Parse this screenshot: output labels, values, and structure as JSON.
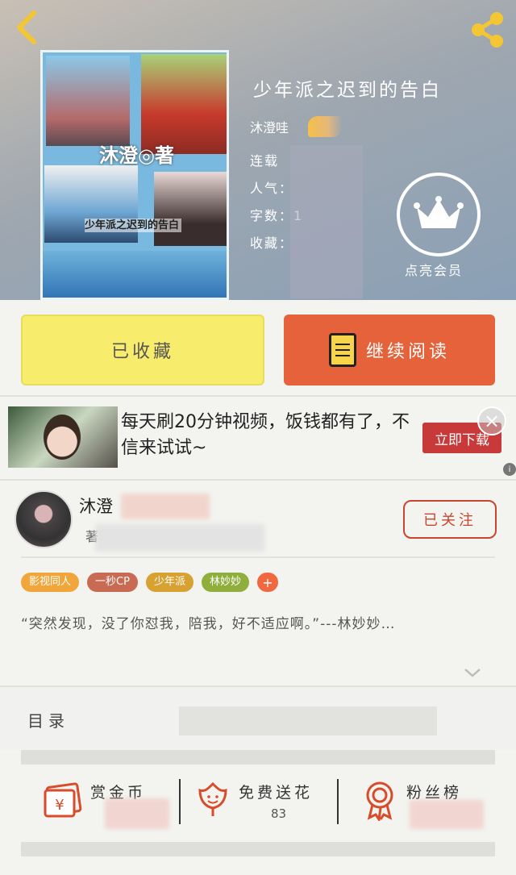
{
  "book": {
    "title": "少年派之迟到的告白",
    "author": "沐澄哇",
    "status_label": "连载",
    "popularity_label": "人气：",
    "wordcount_label": "字数：1",
    "collect_label": "收藏："
  },
  "cover": {
    "logo_text": "沐澄◎著",
    "caption": "少年派之迟到的告白"
  },
  "vip": {
    "label": "点亮会员"
  },
  "actions": {
    "favorite_label": "已收藏",
    "read_label": "继续阅读"
  },
  "ad": {
    "text": "每天刷20分钟视频，饭钱都有了，不信来试试~",
    "button_label": "立即下载",
    "close_glyph": "×"
  },
  "author_row": {
    "name": "沐澄",
    "sub": "著",
    "follow_label": "已关注"
  },
  "tags": [
    {
      "label": "影视同人",
      "color": "#f0a63a"
    },
    {
      "label": "一秒CP",
      "color": "#c96a52"
    },
    {
      "label": "少年派",
      "color": "#d8a232"
    },
    {
      "label": "林妙妙",
      "color": "#8fae3c"
    }
  ],
  "tag_more": "+",
  "description": "“突然发现，没了你怼我，陪我，好不适应啊。”---林妙妙…",
  "catalog": {
    "label": "目录"
  },
  "stats": {
    "reward": {
      "label": "赏金币"
    },
    "flower": {
      "label": "免费送花",
      "value": "83"
    },
    "fans": {
      "label": "粉丝榜"
    }
  },
  "colors": {
    "accent": "#e5623a",
    "favorite_bg": "#f8ec6c",
    "follow": "#c8462f"
  }
}
